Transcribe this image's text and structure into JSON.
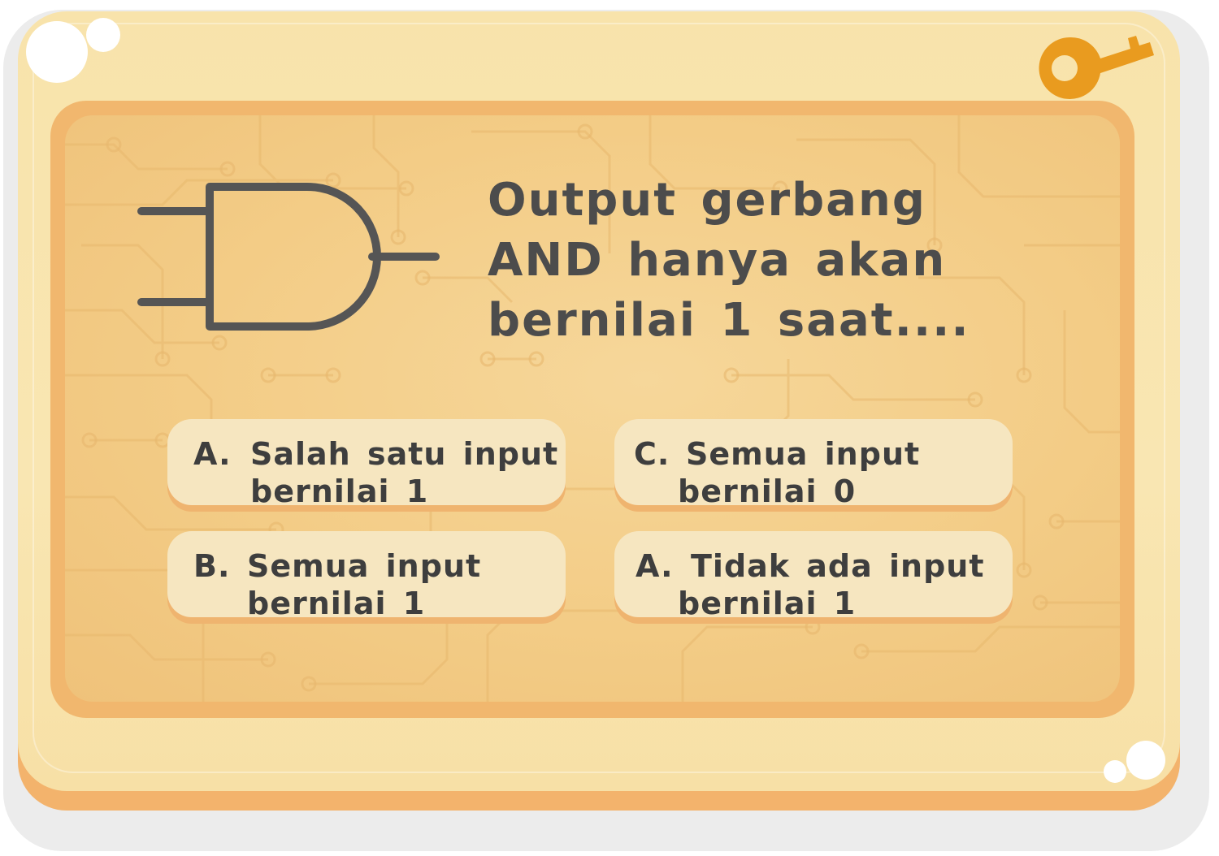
{
  "question": {
    "text": "Output gerbang AND hanya akan bernilai 1 saat...."
  },
  "answers": [
    {
      "id": "a",
      "letter": "A.",
      "line1": "Salah satu input",
      "line2": "bernilai 1"
    },
    {
      "id": "b",
      "letter": "B.",
      "line1": "Semua input",
      "line2": "bernilai 1"
    },
    {
      "id": "c",
      "letter": "C.",
      "line1": "Semua input",
      "line2": "bernilai 0"
    },
    {
      "id": "d",
      "letter": "A.",
      "line1": "Tidak ada input",
      "line2": "bernilai 1"
    }
  ],
  "icons": {
    "gate": "and-gate-icon",
    "key": "key-icon"
  },
  "colors": {
    "card_face": "#f9e6b2",
    "panel_border": "#f1b76e",
    "panel": "#f3cc86",
    "answer_bg": "#f6e6c0",
    "answer_shadow": "#efb46f",
    "text": "#4c4c4c",
    "gate_stroke": "#555555",
    "key": "#e99b1f"
  }
}
